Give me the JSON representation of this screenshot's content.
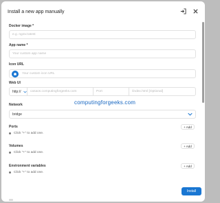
{
  "dialog": {
    "title": "Install a new app manually"
  },
  "fields": {
    "docker_image": {
      "label": "Docker image *",
      "placeholder": "e.g. nginx:latest"
    },
    "app_name": {
      "label": "App name *",
      "placeholder": "Your custom app name"
    },
    "icon_url": {
      "label": "Icon URL",
      "placeholder": "Your custom icon URL"
    },
    "web_ui": {
      "label": "Web UI",
      "protocol": "http://",
      "host_placeholder": "casaos.computingforgeeks.com",
      "port_placeholder": "Port",
      "path_placeholder": "/index.html [Optional]"
    },
    "network": {
      "label": "Network",
      "value": "bridge"
    }
  },
  "sections": [
    {
      "title": "Ports",
      "hint": "Click \"+\" to add one.",
      "add_label": "+ Add"
    },
    {
      "title": "Volumes",
      "hint": "Click \"+\" to add one.",
      "add_label": "+ Add"
    },
    {
      "title": "Environment variables",
      "hint": "Click \"+\" to add one.",
      "add_label": "+ Add"
    }
  ],
  "watermark": "computingforgeeks.com",
  "footer": {
    "install_label": "Install"
  },
  "colors": {
    "accent": "#1976d2",
    "watermark": "#1565c0"
  }
}
